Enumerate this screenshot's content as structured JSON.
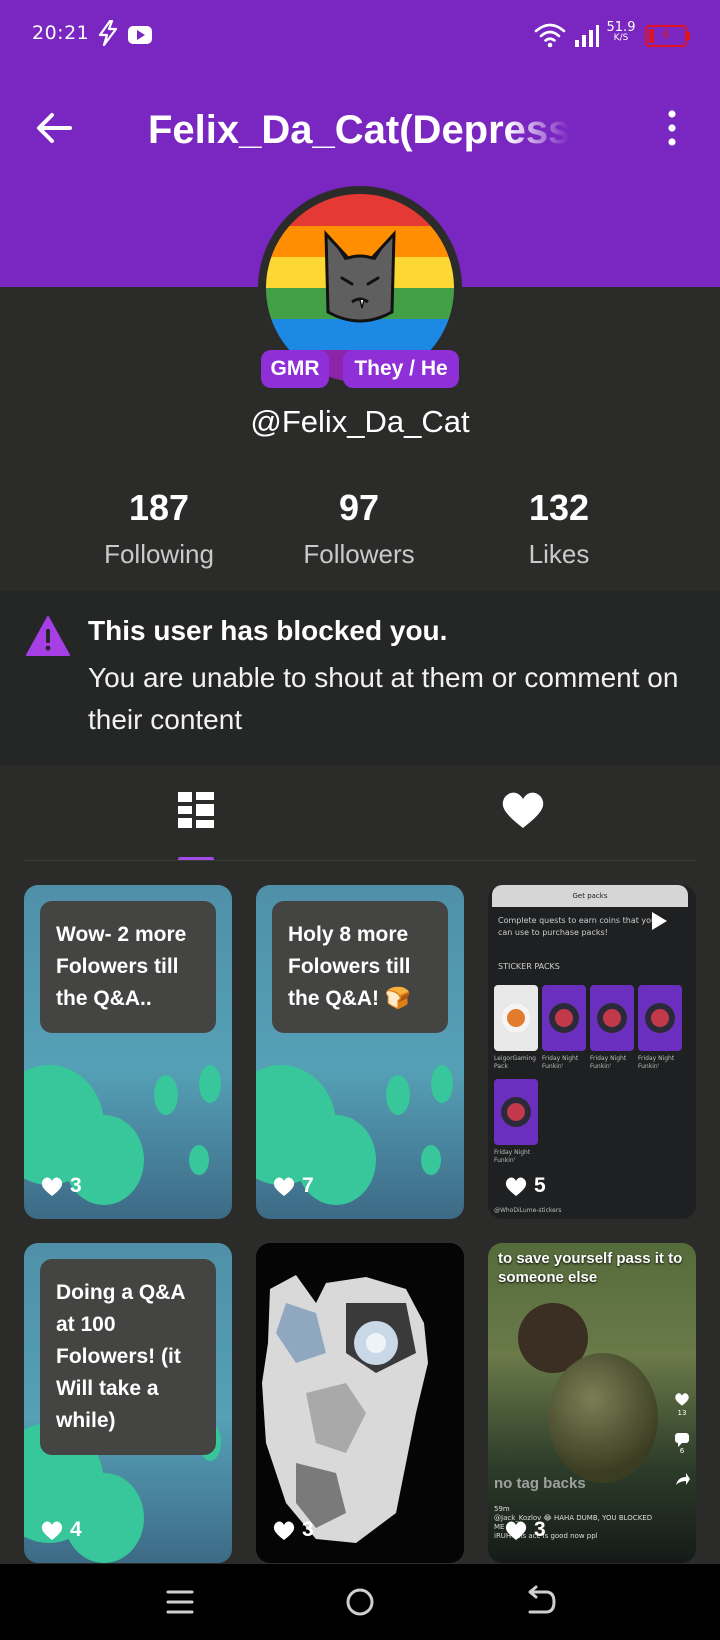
{
  "status_bar": {
    "time": "20:21",
    "net_speed_value": "51.9",
    "net_speed_unit": "K/S",
    "battery_level": "6",
    "battery_color": "#e0121f"
  },
  "header": {
    "title": "Felix_Da_Cat(Depressed",
    "back_icon": "arrow-left-icon",
    "more_icon": "more-vertical-icon"
  },
  "profile": {
    "tags": [
      "GMR",
      "They / He"
    ],
    "handle": "@Felix_Da_Cat",
    "stats": [
      {
        "value": "187",
        "label": "Following"
      },
      {
        "value": "97",
        "label": "Followers"
      },
      {
        "value": "132",
        "label": "Likes"
      }
    ]
  },
  "blocked_notice": {
    "title": "This user has blocked you.",
    "message": "You are unable to shout at them or comment on their content"
  },
  "tabs": [
    {
      "icon": "grid-icon",
      "selected": true
    },
    {
      "icon": "heart-icon",
      "selected": false
    }
  ],
  "posts": [
    {
      "text": "Wow- 2 more Folowers till the Q&A..",
      "likes": "3"
    },
    {
      "text": "Holy 8 more Folowers till the Q&A! 🍞",
      "likes": "7"
    },
    {
      "likes": "5",
      "screenshot": {
        "header": "Get packs",
        "desc": "Complete quests to earn coins that you can use to purchase packs!",
        "section": "STICKER PACKS",
        "packs": [
          "LeigorGaming Pack",
          "Friday Night Funkin'",
          "Friday Night Funkin'",
          "Friday Night Funkin'",
          "Friday Night Funkin'"
        ],
        "footer": "@WhoDiLume-stickers"
      }
    },
    {
      "text": "Doing a Q&A at 100 Folowers! (it Will take a while)",
      "likes": "4"
    },
    {
      "likes": "3"
    },
    {
      "likes": "3",
      "meme": {
        "top_text": "to save yourself pass it to someone else",
        "bottom_text": "no tag backs",
        "comment": "@Jack_Kozlov 😂 HAHA DUMB, YOU BLOCKED ME",
        "comment_time": "59m",
        "reply": "iRUH this acc is good now ppl",
        "side_counts": [
          "13",
          "6"
        ]
      }
    }
  ],
  "accent_color": "#7a26c0"
}
